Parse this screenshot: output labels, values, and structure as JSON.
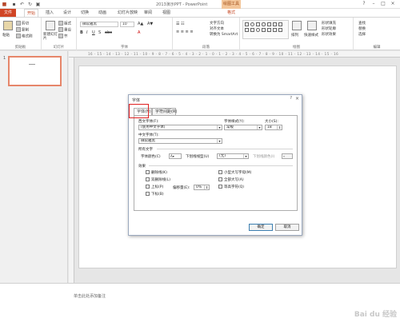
{
  "app": {
    "title": "2013演示PPT - PowerPoint",
    "contextual_tab": "绘图工具"
  },
  "tabs": [
    "文件",
    "开始",
    "插入",
    "设计",
    "切换",
    "动画",
    "幻灯片放映",
    "审阅",
    "视图",
    "格式"
  ],
  "ribbon": {
    "clipboard": {
      "paste": "粘贴",
      "cut": "剪切",
      "copy": "复制",
      "format_painter": "格式刷",
      "label": "剪贴板"
    },
    "slides": {
      "new_slide": "新建幻灯片",
      "layout": "版式",
      "reset": "重设",
      "section": "节",
      "label": "幻灯片"
    },
    "font": {
      "font_name": "微软雅黑",
      "font_size": "10",
      "label": "字体"
    },
    "paragraph": {
      "text_direction": "文字方向",
      "align_text": "对齐文本",
      "smartart": "转换为 SmartArt",
      "label": "段落"
    },
    "drawing": {
      "arrange": "排列",
      "quick_styles": "快速样式",
      "shape_fill": "形状填充",
      "shape_outline": "形状轮廓",
      "shape_effects": "形状效果",
      "label": "绘图"
    },
    "editing": {
      "find": "查找",
      "replace": "替换",
      "select": "选择",
      "label": "编辑"
    }
  },
  "thumbnails": {
    "slide_number": "1"
  },
  "ruler_text": "16 · 15 · 14 · 13 · 12 · 11 · 10 · 9 · 8 · 7 · 6 · 5 · 4 · 3 · 2 · 1 · 0 · 1 · 2 · 3 · 4 · 5 · 6 · 7 · 8 · 9 · 10 · 11 · 12 · 13 · 14 · 15 · 16",
  "notes_placeholder": "单击此处添加备注",
  "dialog": {
    "title": "字体",
    "help": "?",
    "close": "×",
    "tabs": [
      "字体(N)",
      "字符间距(R)"
    ],
    "latin_font_label": "西文字体(F):",
    "latin_font_value": "(使用中文字体)",
    "style_label": "字体样式(Y):",
    "style_value": "常规",
    "size_label": "大小(S):",
    "size_value": "18",
    "asian_font_label": "中文字体(T):",
    "asian_font_value": "微软雅黑",
    "all_text_label": "所有文字",
    "font_color_label": "字体颜色(C)",
    "underline_style_label": "下划线线型(U)",
    "underline_style_value": "(无)",
    "underline_color_label": "下划线颜色(I)",
    "effects_label": "效果",
    "effects": {
      "strikethrough": "删除线(K)",
      "double_strikethrough": "双删除线(L)",
      "superscript": "上标(P)",
      "subscript": "下标(B)",
      "offset_label": "偏移量(E):",
      "offset_value": "0%",
      "small_caps": "小型大写字母(M)",
      "all_caps": "全部大写(A)",
      "equalize_height": "等高字符(Q)"
    },
    "ok": "确定",
    "cancel": "取消"
  },
  "watermark": "Bai du 经验",
  "colors": {
    "accent": "#d04525",
    "highlight": "#e02020"
  }
}
